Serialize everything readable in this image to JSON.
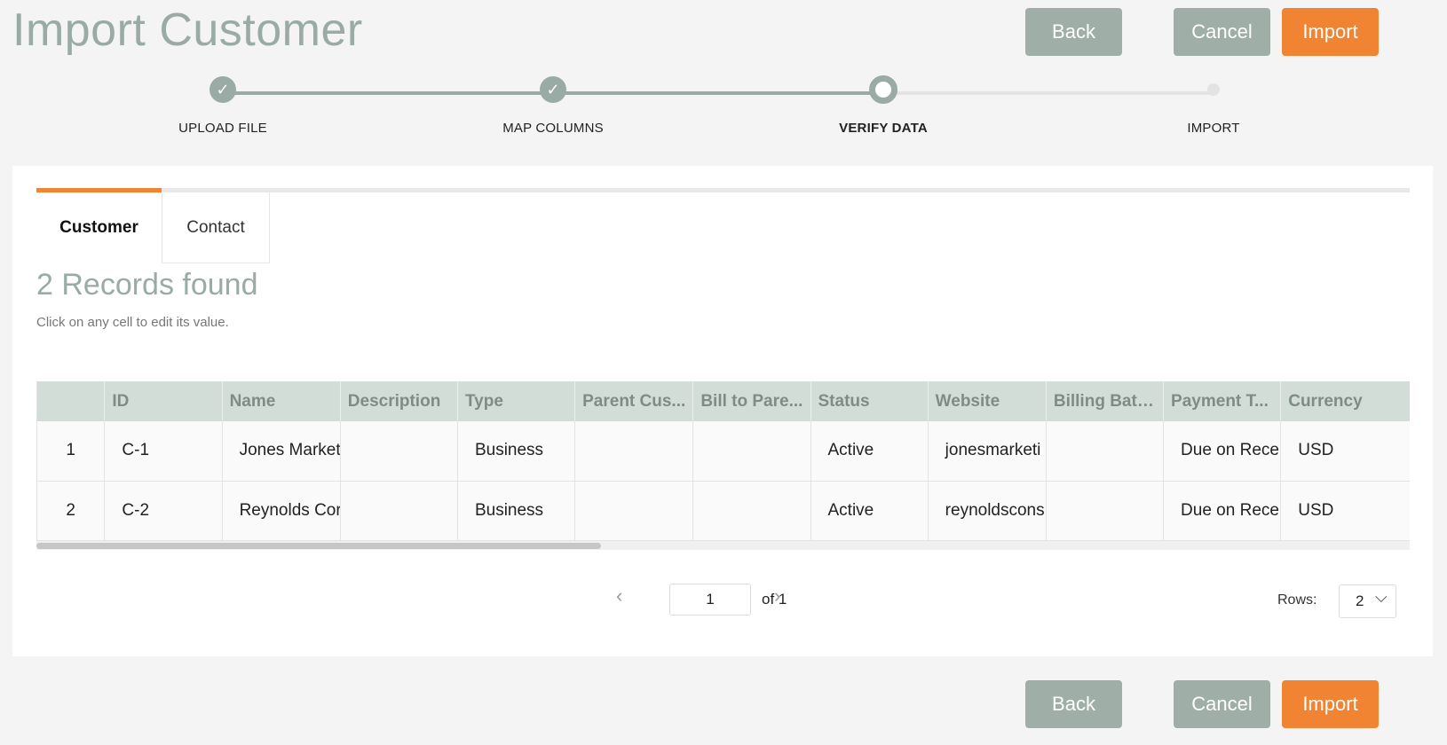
{
  "page": {
    "title": "Import Customer"
  },
  "actions": {
    "back": "Back",
    "cancel": "Cancel",
    "import": "Import"
  },
  "colors": {
    "accent": "#f08432",
    "muted": "#9aaaa4",
    "header_bg": "#d3ddd7"
  },
  "steps": [
    {
      "label": "UPLOAD FILE",
      "state": "done",
      "icon": "check-icon"
    },
    {
      "label": "MAP COLUMNS",
      "state": "done",
      "icon": "check-icon"
    },
    {
      "label": "VERIFY DATA",
      "state": "current"
    },
    {
      "label": "IMPORT",
      "state": "todo"
    }
  ],
  "tabs": [
    {
      "label": "Customer",
      "active": true
    },
    {
      "label": "Contact",
      "active": false
    }
  ],
  "records": {
    "title": "2 Records found",
    "hint": "Click on any cell to edit its value."
  },
  "table": {
    "columns": [
      "",
      "ID",
      "Name",
      "Description",
      "Type",
      "Parent Cus...",
      "Bill to Pare...",
      "Status",
      "Website",
      "Billing Batch",
      "Payment T...",
      "Currency"
    ],
    "rows": [
      [
        "1",
        "C-1",
        "Jones Market",
        "",
        "Business",
        "",
        "",
        "Active",
        "jonesmarketi",
        "",
        "Due on Recei",
        "USD"
      ],
      [
        "2",
        "C-2",
        "Reynolds Cor",
        "",
        "Business",
        "",
        "",
        "Active",
        "reynoldscons",
        "",
        "Due on Recei",
        "USD"
      ]
    ]
  },
  "pagination": {
    "page": "1",
    "of_label": "of 1",
    "rows_label": "Rows:",
    "rows_value": "2"
  }
}
